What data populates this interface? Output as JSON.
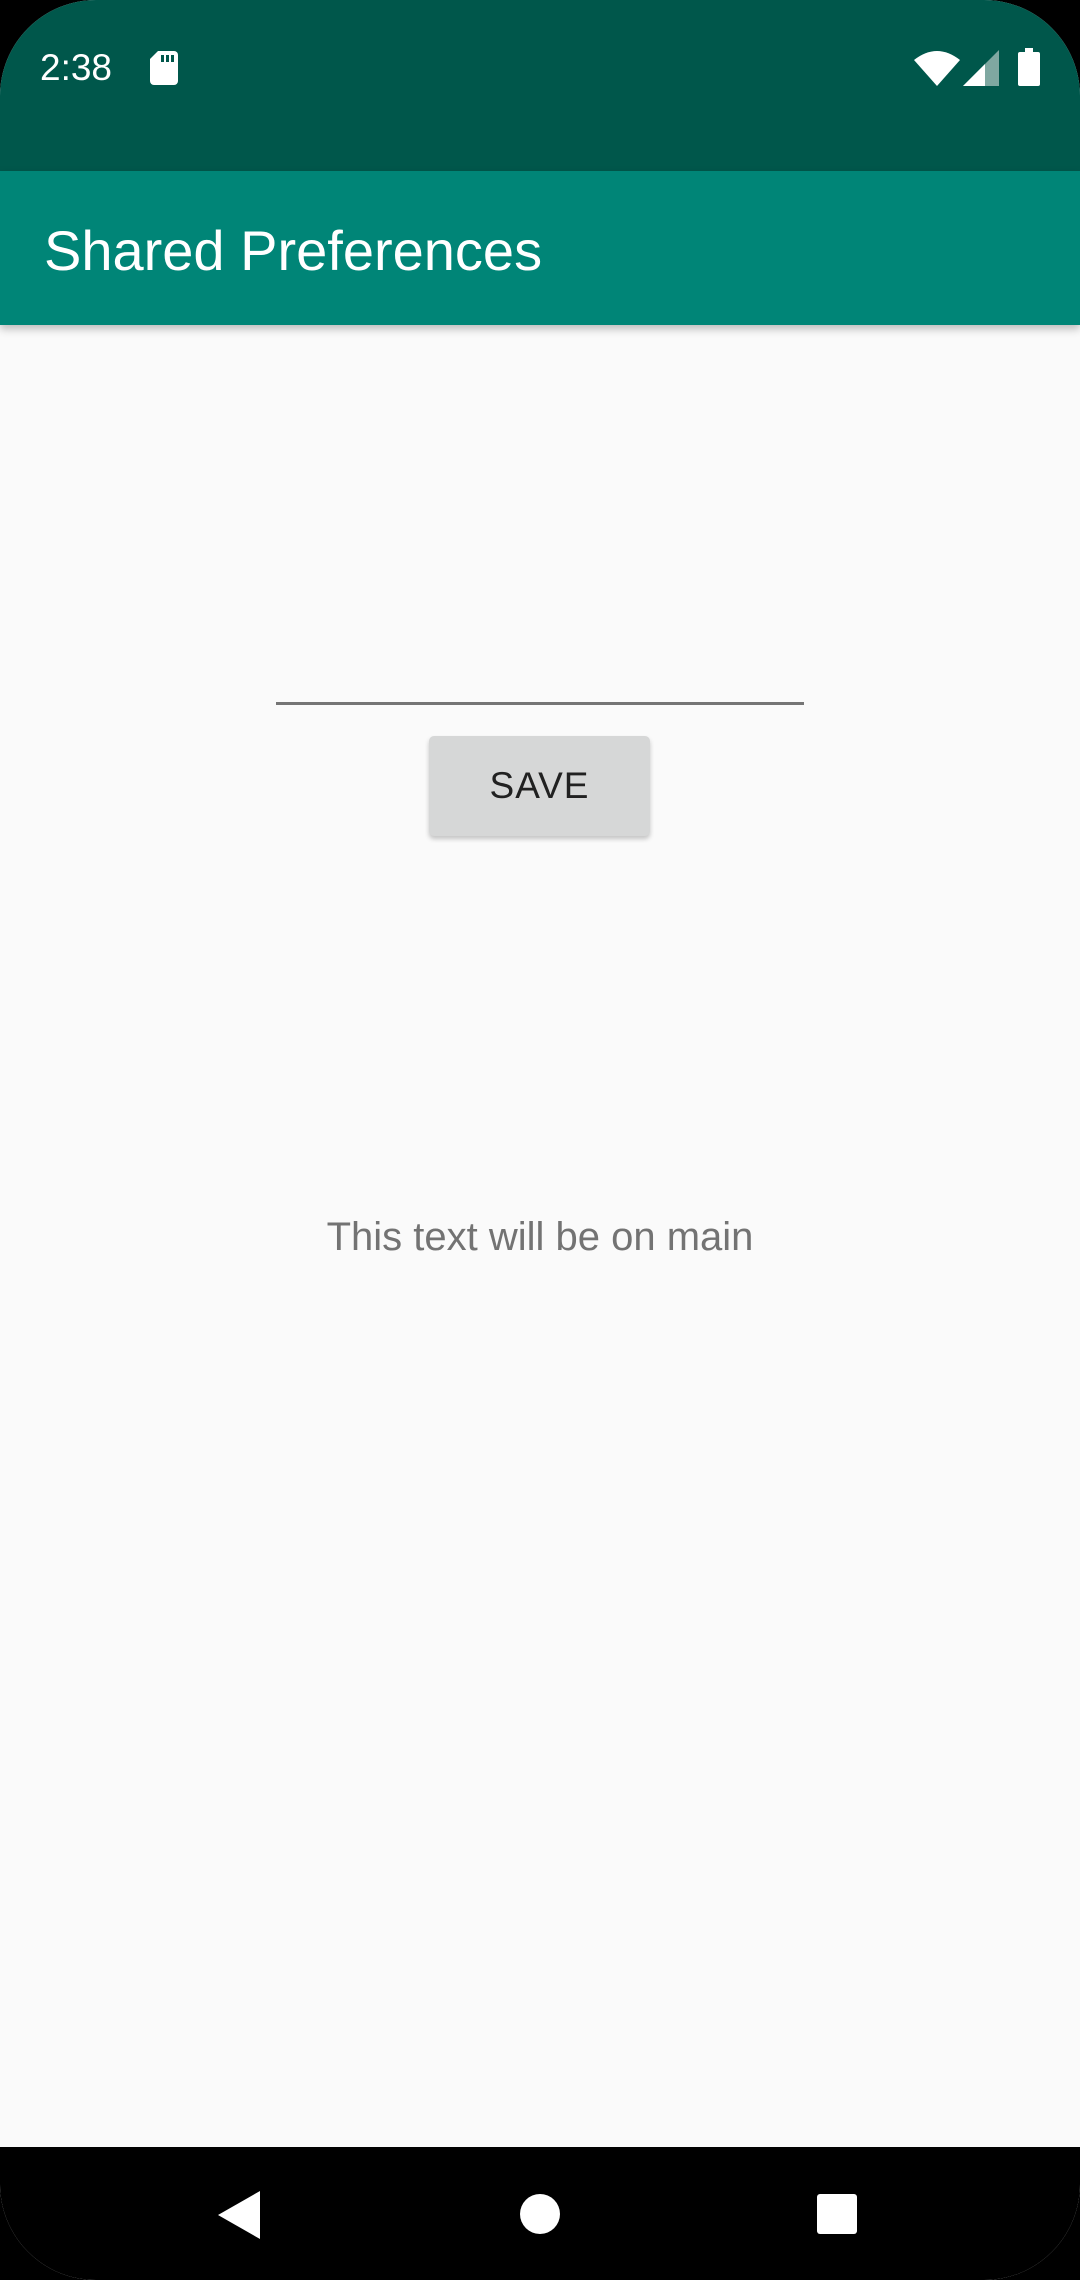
{
  "status_bar": {
    "time": "2:38",
    "icons": [
      "sd-card-icon",
      "wifi-icon",
      "cellular-signal-icon",
      "battery-icon"
    ]
  },
  "app_bar": {
    "title": "Shared Preferences"
  },
  "main": {
    "input": {
      "value": "",
      "placeholder": ""
    },
    "save_label": "SAVE",
    "display_text": "This text will be on main"
  },
  "nav_bar": {
    "icons": [
      "back-icon",
      "home-icon",
      "recents-icon"
    ]
  },
  "colors": {
    "status_bar": "#00574b",
    "app_bar": "#008577",
    "background": "#fafafa",
    "button": "#d6d7d7",
    "nav_bar": "#000000"
  }
}
